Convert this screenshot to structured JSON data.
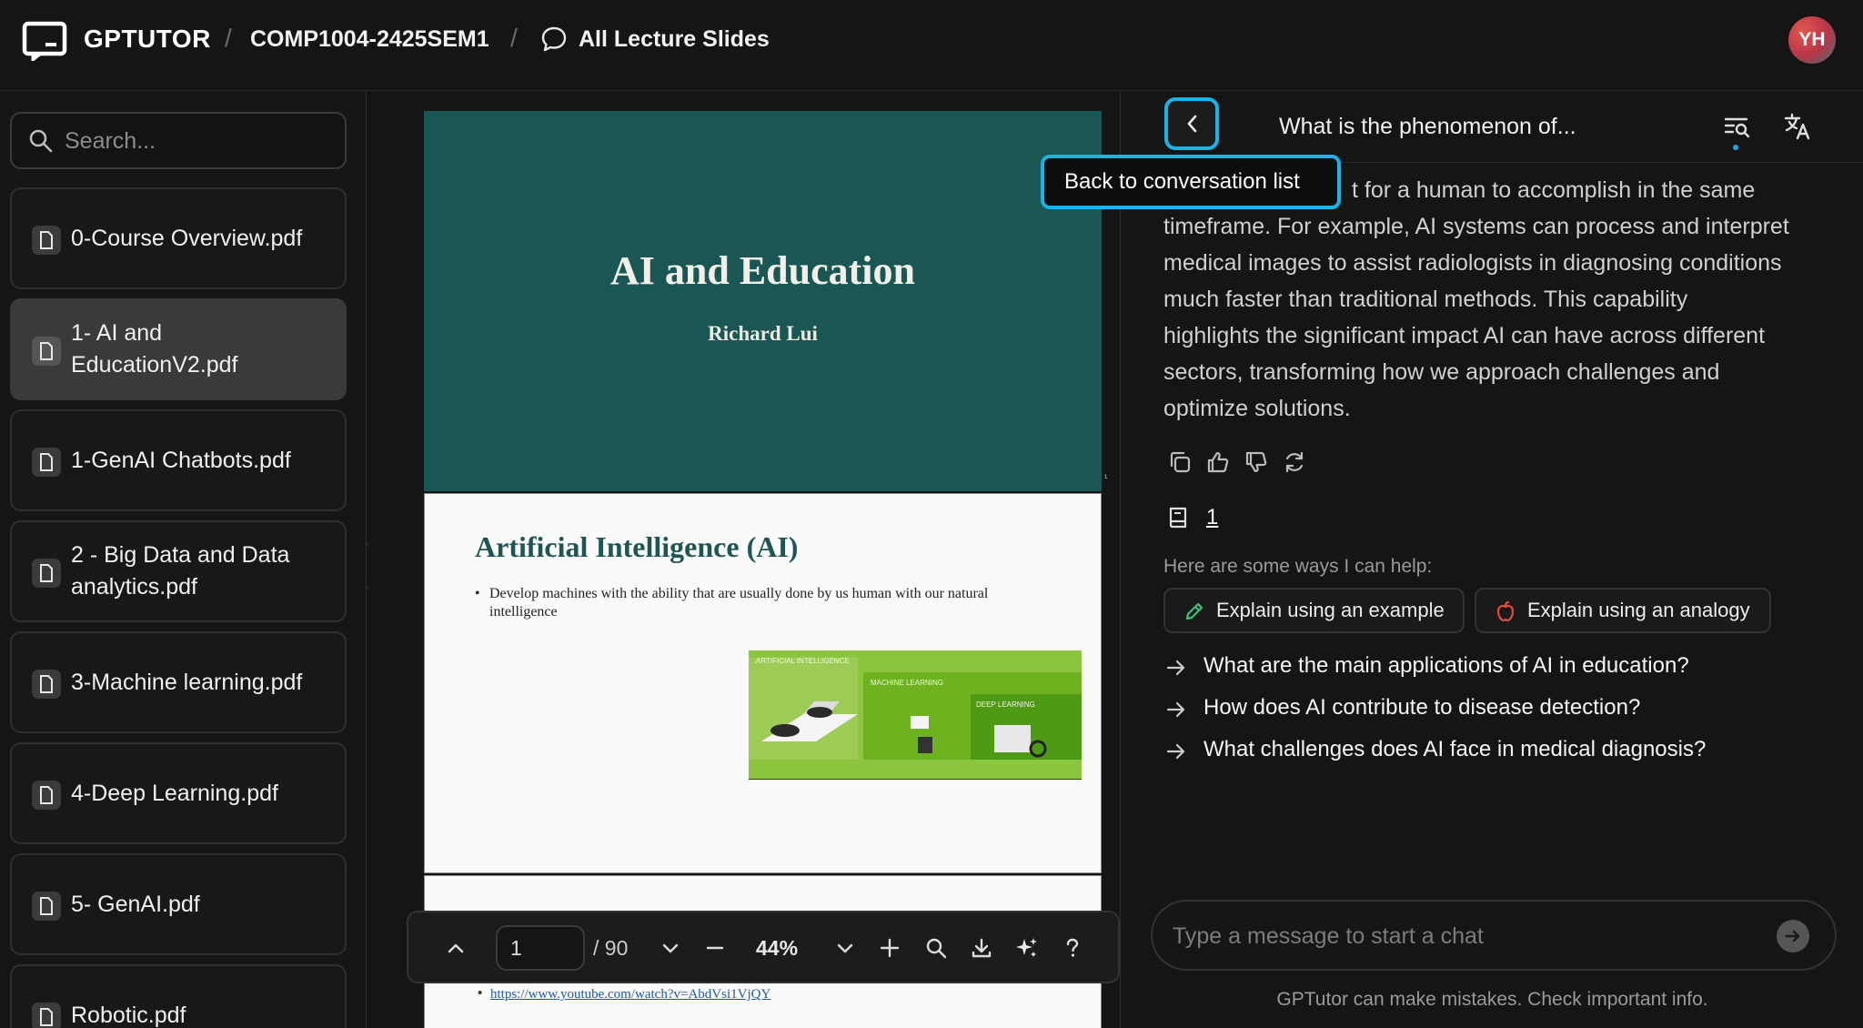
{
  "header": {
    "brand": "GPTUTOR",
    "sep": "/",
    "course": "COMP1004-2425SEM1",
    "section": "All Lecture Slides",
    "avatar_initials": "YH"
  },
  "sidebar": {
    "search_placeholder": "Search...",
    "files": [
      {
        "label": "0-Course Overview.pdf"
      },
      {
        "label": "1- AI and EducationV2.pdf"
      },
      {
        "label": "1-GenAI Chatbots.pdf"
      },
      {
        "label": "2 - Big Data and Data analytics.pdf"
      },
      {
        "label": "3-Machine learning.pdf"
      },
      {
        "label": "4-Deep Learning.pdf"
      },
      {
        "label": "5- GenAI.pdf"
      },
      {
        "label": "Robotic.pdf"
      }
    ]
  },
  "viewer": {
    "slide1": {
      "title": "AI and Education",
      "author": "Richard Lui",
      "page_num": "1"
    },
    "slide2": {
      "title": "Artificial Intelligence (AI)",
      "bullet": "Develop machines with the ability that are usually done by us human with our natural intelligence",
      "fig_labels": [
        "ARTIFICIAL INTELLIGENCE",
        "MACHINE LEARNING",
        "DEEP LEARNING"
      ]
    },
    "slide3": {
      "link": "https://www.youtube.com/watch?v=AbdVsi1VjQY"
    },
    "toolbar": {
      "page": "1",
      "total": "/ 90",
      "zoom": "44%"
    }
  },
  "chat": {
    "title": "What is the phenomenon of...",
    "tooltip": "Back to conversation list",
    "answer_lines": [
      "t for a human to accomplish in the same",
      "timeframe. For example, AI systems can process and interpret",
      "medical images to assist radiologists in diagnosing conditions",
      "much faster than traditional methods. This capability",
      "highlights the significant impact AI can have across different",
      "sectors, transforming how we approach challenges and",
      "optimize solutions."
    ],
    "reference_count": "1",
    "help_label": "Here are some ways I can help:",
    "chips": [
      "Explain using an example",
      "Explain using an analogy"
    ],
    "suggestions": [
      "What are the main applications of AI in education?",
      "How does AI contribute to disease detection?",
      "What challenges does AI face in medical diagnosis?"
    ],
    "input_placeholder": "Type a message to start a chat",
    "disclaimer": "GPTutor can make mistakes. Check important info."
  },
  "colors": {
    "accent": "#18b4e8",
    "slide_teal": "#1a5654",
    "background": "#151515"
  }
}
